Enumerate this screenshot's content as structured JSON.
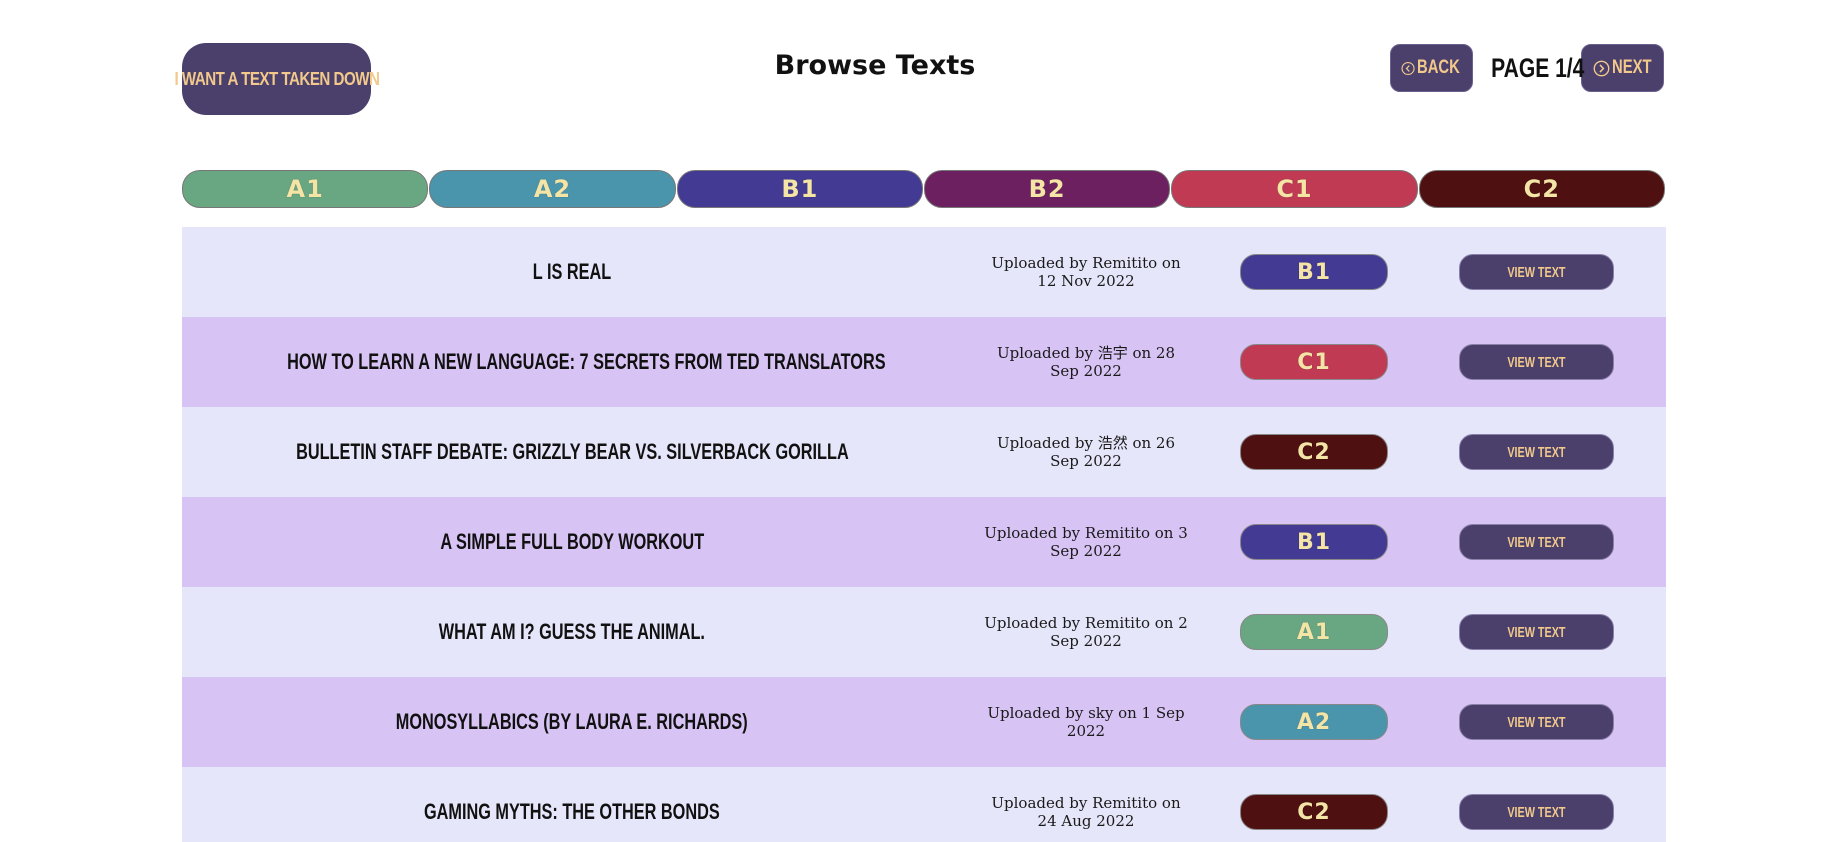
{
  "header": {
    "takedown_label": "I want a text taken down",
    "title": "Browse Texts",
    "back_label": "Back",
    "next_label": "Next",
    "page_indicator": "Page 1/4"
  },
  "levels": [
    {
      "label": "A1",
      "color": "#69a682"
    },
    {
      "label": "A2",
      "color": "#4b95ac"
    },
    {
      "label": "B1",
      "color": "#433a94"
    },
    {
      "label": "B2",
      "color": "#6d2060"
    },
    {
      "label": "C1",
      "color": "#c03a54"
    },
    {
      "label": "C2",
      "color": "#4e1010"
    }
  ],
  "texts": [
    {
      "title": "L is real",
      "meta": "Uploaded by Remitito on 12 Nov 2022",
      "level": "B1",
      "level_color": "#433a94",
      "action": "View text"
    },
    {
      "title": "How to learn a new language: 7 secrets from TED translators",
      "meta": "Uploaded by 浩宇 on 28 Sep 2022",
      "level": "C1",
      "level_color": "#c03a54",
      "action": "View text"
    },
    {
      "title": "Bulletin Staff Debate: Grizzly Bear vs. Silverback Gorilla",
      "meta": "Uploaded by 浩然 on 26 Sep 2022",
      "level": "C2",
      "level_color": "#4e1010",
      "action": "View text"
    },
    {
      "title": "A Simple Full Body Workout",
      "meta": "Uploaded by Remitito on 3 Sep 2022",
      "level": "B1",
      "level_color": "#433a94",
      "action": "View text"
    },
    {
      "title": "What am I? Guess the animal.",
      "meta": "Uploaded by Remitito on 2 Sep 2022",
      "level": "A1",
      "level_color": "#69a682",
      "action": "View text"
    },
    {
      "title": "Monosyllabics (by Laura E. Richards)",
      "meta": "Uploaded by sky on 1 Sep 2022",
      "level": "A2",
      "level_color": "#4b95ac",
      "action": "View text"
    },
    {
      "title": "Gaming Myths: The Other Bonds",
      "meta": "Uploaded by Remitito on 24 Aug 2022",
      "level": "C2",
      "level_color": "#4e1010",
      "action": "View text"
    }
  ]
}
